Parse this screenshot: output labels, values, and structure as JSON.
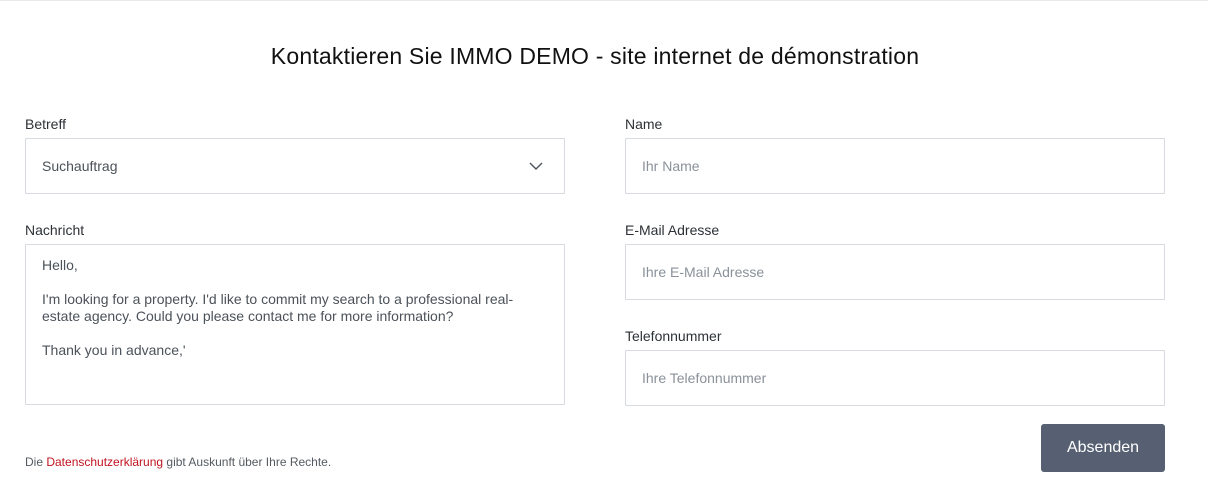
{
  "title": "Kontaktieren Sie IMMO DEMO - site internet de démonstration",
  "subject": {
    "label": "Betreff",
    "selected": "Suchauftrag",
    "icon": "chevron-down-icon"
  },
  "message": {
    "label": "Nachricht",
    "value": "Hello,\n\nI'm looking for a property. I'd like to commit my search to a professional real-estate agency. Could you please contact me for more information?\n\nThank you in advance,'"
  },
  "name": {
    "label": "Name",
    "placeholder": "Ihr Name"
  },
  "email": {
    "label": "E-Mail Adresse",
    "placeholder": "Ihre E-Mail Adresse"
  },
  "phone": {
    "label": "Telefonnummer",
    "placeholder": "Ihre Telefonnummer"
  },
  "privacy": {
    "prefix": "Die ",
    "link": "Datenschutzerklärung",
    "suffix": " gibt Auskunft über Ihre Rechte."
  },
  "submit_label": "Absenden",
  "colors": {
    "button_bg": "#566072",
    "link": "#c1121f",
    "border": "#d7dbe0"
  }
}
